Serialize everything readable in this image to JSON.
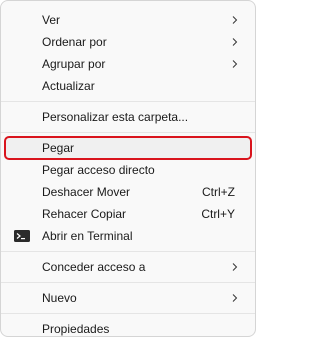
{
  "menu": {
    "group1": [
      {
        "label": "Ver",
        "submenu": true
      },
      {
        "label": "Ordenar por",
        "submenu": true
      },
      {
        "label": "Agrupar por",
        "submenu": true
      },
      {
        "label": "Actualizar",
        "submenu": false
      }
    ],
    "group2": [
      {
        "label": "Personalizar esta carpeta..."
      }
    ],
    "group3": [
      {
        "label": "Pegar",
        "highlighted": true
      },
      {
        "label": "Pegar acceso directo"
      },
      {
        "label": "Deshacer Mover",
        "shortcut": "Ctrl+Z"
      },
      {
        "label": "Rehacer Copiar",
        "shortcut": "Ctrl+Y"
      },
      {
        "label": "Abrir en Terminal",
        "icon": "terminal-icon"
      }
    ],
    "group4": [
      {
        "label": "Conceder acceso a",
        "submenu": true
      }
    ],
    "group5": [
      {
        "label": "Nuevo",
        "submenu": true
      }
    ],
    "group6": [
      {
        "label": "Propiedades"
      }
    ]
  },
  "colors": {
    "highlight_outline": "#d9141d",
    "menu_bg": "#f9f9f9",
    "text": "#1a1a1a"
  }
}
